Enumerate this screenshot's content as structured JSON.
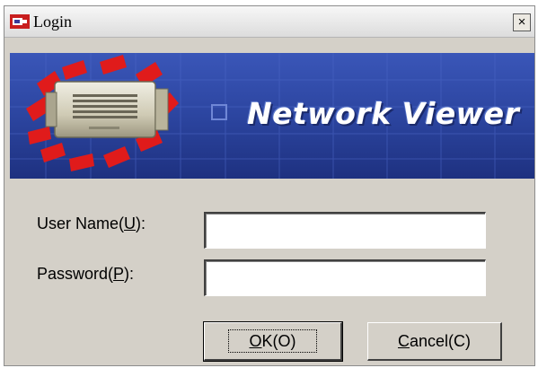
{
  "window": {
    "title": "Login",
    "close_glyph": "×"
  },
  "banner": {
    "brand": "Network Viewer"
  },
  "form": {
    "user_label_pre": "User Name(",
    "user_label_key": "U",
    "user_label_post": "):",
    "user_value": "",
    "pass_label_pre": "Password(",
    "pass_label_key": "P",
    "pass_label_post": "):",
    "pass_value": ""
  },
  "buttons": {
    "ok_key": "O",
    "ok_rest": "K(O)",
    "cancel_key": "C",
    "cancel_rest": "ancel(C)"
  },
  "colors": {
    "window_bg": "#d4d0c8",
    "banner_blue": "#2f4aa6",
    "accent_red": "#e01b1b"
  },
  "icons": {
    "app": "camera-app-icon",
    "close": "close-icon",
    "banner": "ip-camera-icon"
  }
}
